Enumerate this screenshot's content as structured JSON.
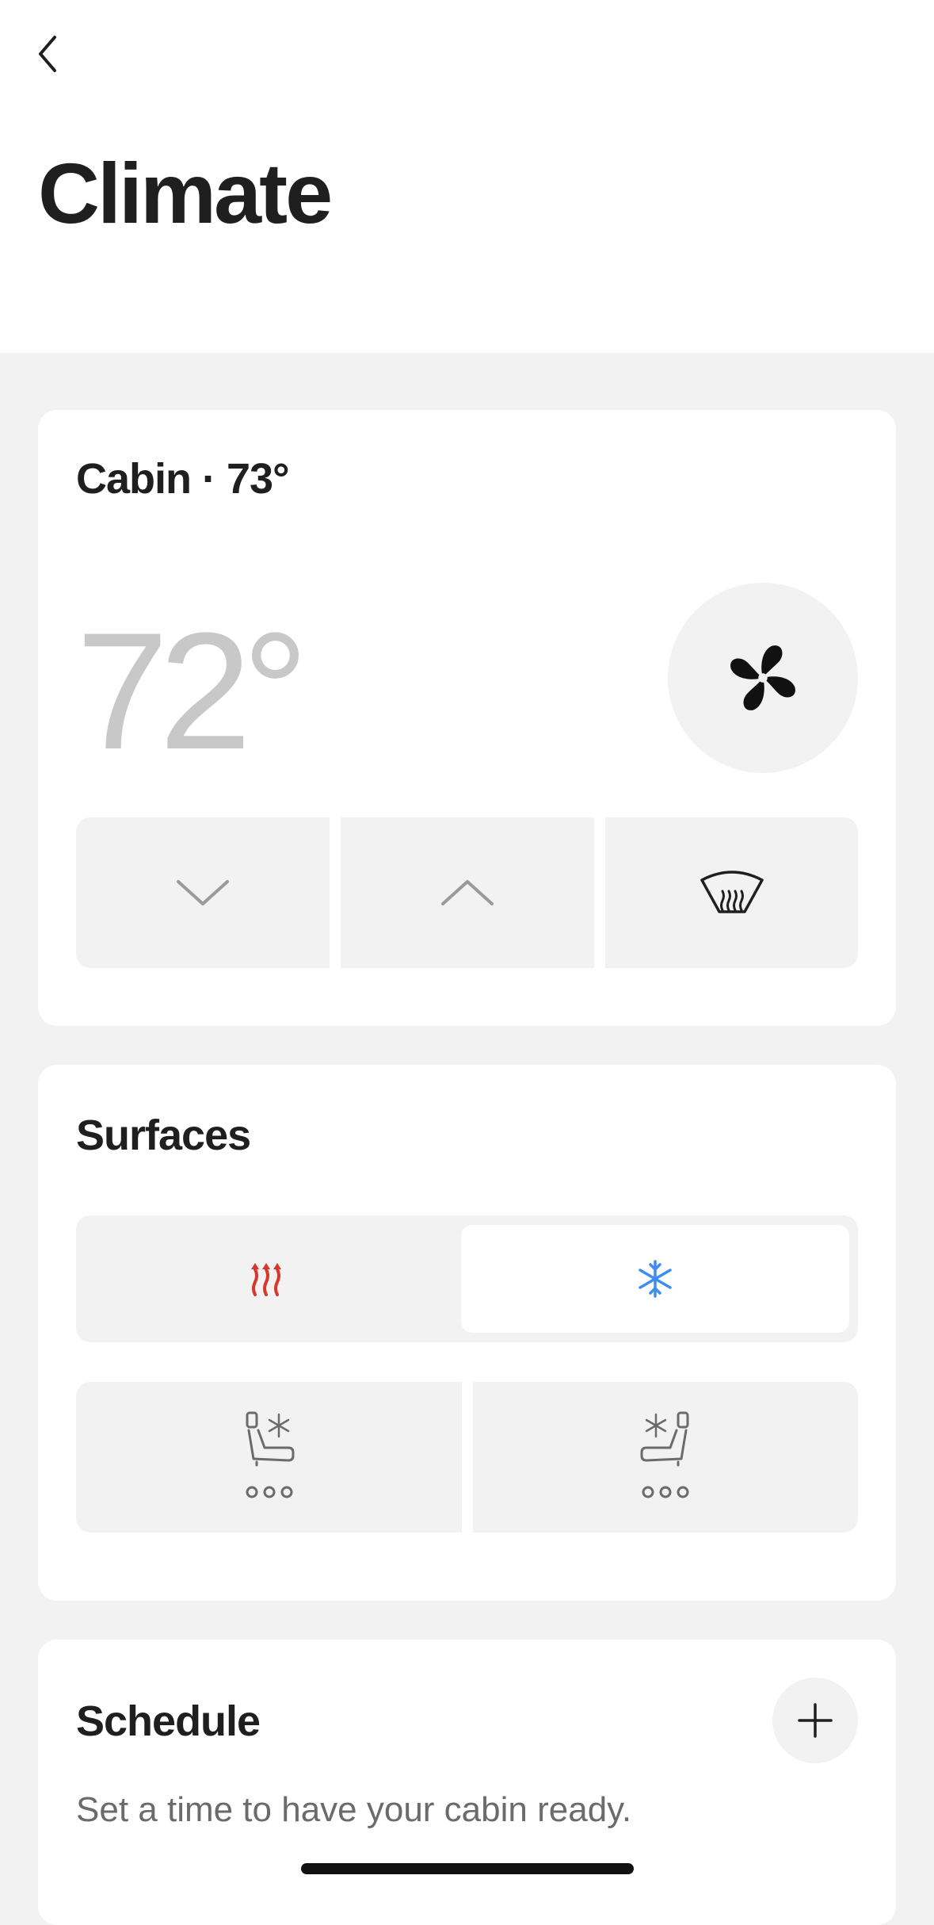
{
  "page": {
    "title": "Climate"
  },
  "cabin": {
    "title": "Cabin · 73°",
    "set_temperature": "72°"
  },
  "surfaces": {
    "title": "Surfaces"
  },
  "schedule": {
    "title": "Schedule",
    "description": "Set a time to have your cabin ready."
  },
  "icons": {
    "back": "chevron-left-icon",
    "fan": "fan-icon",
    "down": "chevron-down-icon",
    "up": "chevron-up-icon",
    "defrost": "front-defrost-icon",
    "heat": "heat-waves-icon",
    "cool": "snowflake-icon",
    "seat_left": "left-seat-cool-icon",
    "seat_right": "right-seat-cool-icon",
    "add": "plus-icon"
  },
  "colors": {
    "heat": "#d6392b",
    "cool": "#3d8ef0",
    "background": "#f2f2f2",
    "card": "#ffffff"
  }
}
